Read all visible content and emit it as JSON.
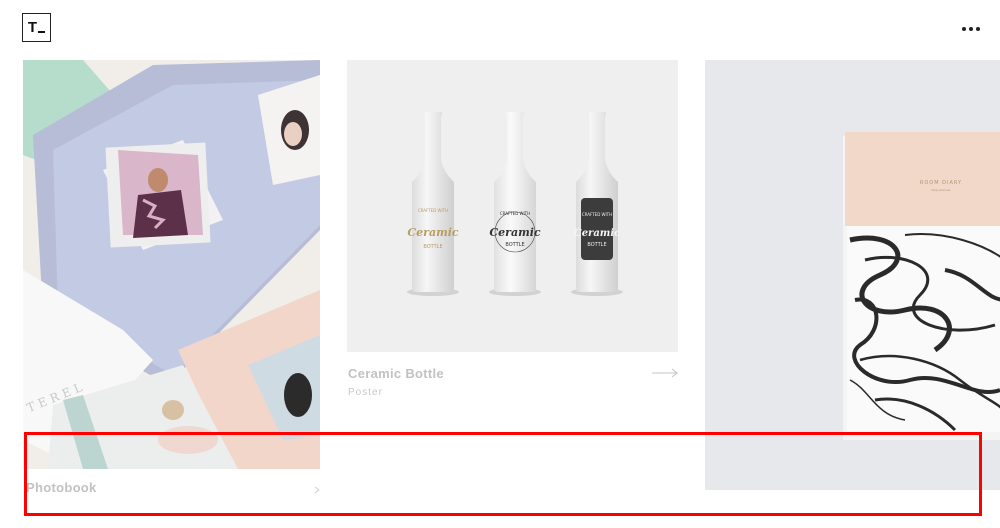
{
  "header": {
    "logo_text": "T",
    "menu_icon": "more-horizontal-icon"
  },
  "portfolio": [
    {
      "title": "Photobook",
      "category": ""
    },
    {
      "title": "Ceramic Bottle",
      "category": "Poster"
    },
    {
      "title": "",
      "category": ""
    }
  ],
  "bottle_labels": {
    "crafted": "CRAFTED WITH",
    "brand": "Ceramic",
    "bottle": "BOTTLE",
    "mockup": "PHOTOSHOP MOCKUP"
  },
  "diary": {
    "title": "ROOM DIARY",
    "subtitle": "daily planner"
  },
  "photobook_text": "TEREL",
  "colors": {
    "highlight": "#ff0000",
    "meta_text": "#c2c2c2"
  }
}
